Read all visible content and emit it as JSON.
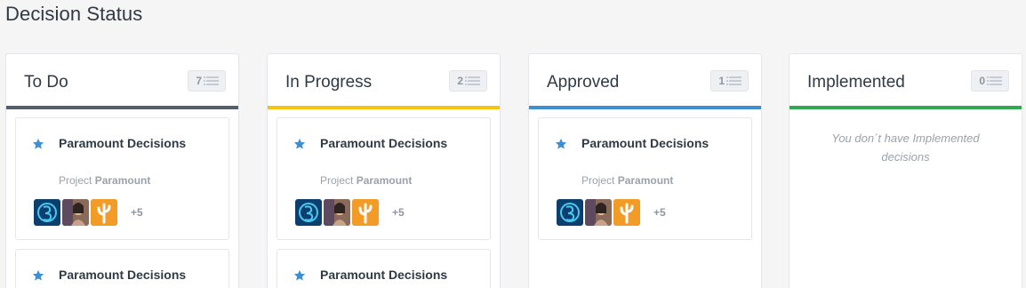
{
  "page_title": "Decision Status",
  "columns": [
    {
      "title": "To Do",
      "count": "7",
      "accent": "#555f6b",
      "cards": [
        {
          "title": "Paramount Decisions",
          "project_prefix": "Project",
          "project_name": "Paramount",
          "more": "+5"
        },
        {
          "title": "Paramount Decisions"
        }
      ]
    },
    {
      "title": "In Progress",
      "count": "2",
      "accent": "#f2c40f",
      "cards": [
        {
          "title": "Paramount Decisions",
          "project_prefix": "Project",
          "project_name": "Paramount",
          "more": "+5"
        },
        {
          "title": "Paramount Decisions"
        }
      ]
    },
    {
      "title": "Approved",
      "count": "1",
      "accent": "#3d8fd1",
      "cards": [
        {
          "title": "Paramount Decisions",
          "project_prefix": "Project",
          "project_name": "Paramount",
          "more": "+5"
        }
      ]
    },
    {
      "title": "Implemented",
      "count": "0",
      "accent": "#33a852",
      "empty_message": "You don´t have Implemented decisions",
      "cards": []
    }
  ],
  "icons": {
    "star": "star-icon",
    "count": "list-icon",
    "avatar_1": "compass-logo-avatar",
    "avatar_2": "user-photo-avatar",
    "avatar_3": "cactus-avatar"
  },
  "colors": {
    "star": "#3d8fd1",
    "avatar_1_bg": "#0b3f6e",
    "avatar_3_bg": "#f29b27"
  }
}
